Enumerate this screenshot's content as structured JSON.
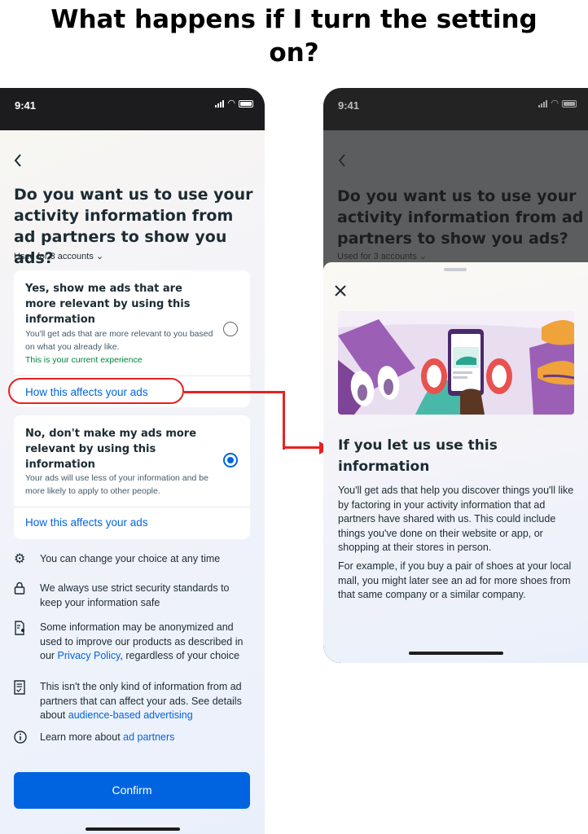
{
  "headline": {
    "line1": "What happens if I turn the setting",
    "line2": "on?"
  },
  "left_screen": {
    "time": "9:41",
    "title": "Do you want us to use your activity information from ad partners to show you ads?",
    "accounts": "Used for 3 accounts",
    "option_yes": {
      "title": "Yes, show me ads that are more relevant by using this information",
      "description": "You'll get ads that are more relevant to you based on what you already like.",
      "current": "This is your current experience",
      "link": "How this affects your ads",
      "selected": false
    },
    "option_no": {
      "title": "No, don't make my ads more relevant by using this information",
      "description": "Your ads will use less of your information and be more likely to apply to other people.",
      "link": "How this affects your ads",
      "selected": true
    },
    "info": {
      "item1": "You can change your choice at any time",
      "item2": "We always use strict security standards to keep your information safe",
      "item3_pre": "Some information may be anonymized and used to improve our products as described in our ",
      "item3_link": "Privacy Policy",
      "item3_post": ", regardless of your choice",
      "item4_pre": "This isn't the only kind of information from ad partners that can affect your ads. See details about ",
      "item4_link": "audience-based advertising",
      "item5_pre": "Learn more about ",
      "item5_link": "ad partners"
    },
    "confirm": "Confirm"
  },
  "right_screen": {
    "time": "9:41",
    "title": "Do you want us to use your activity information from ad partners to show you ads?",
    "accounts": "Used for 3 accounts",
    "sheet": {
      "title": "If you let us use this information",
      "paragraph1": "You'll get ads that help you discover things you'll like by factoring in your activity information that ad partners have shared with us. This could include things you've done on their website or app, or shopping at their stores in person.",
      "paragraph2": "For example, if you buy a pair of shoes at your local mall, you might later see an ad for more shoes from that same company or a similar company."
    }
  },
  "colors": {
    "accent": "#0064e0",
    "highlight": "#e52222",
    "success": "#00843d",
    "illustration_purple": "#9b5fb5"
  }
}
